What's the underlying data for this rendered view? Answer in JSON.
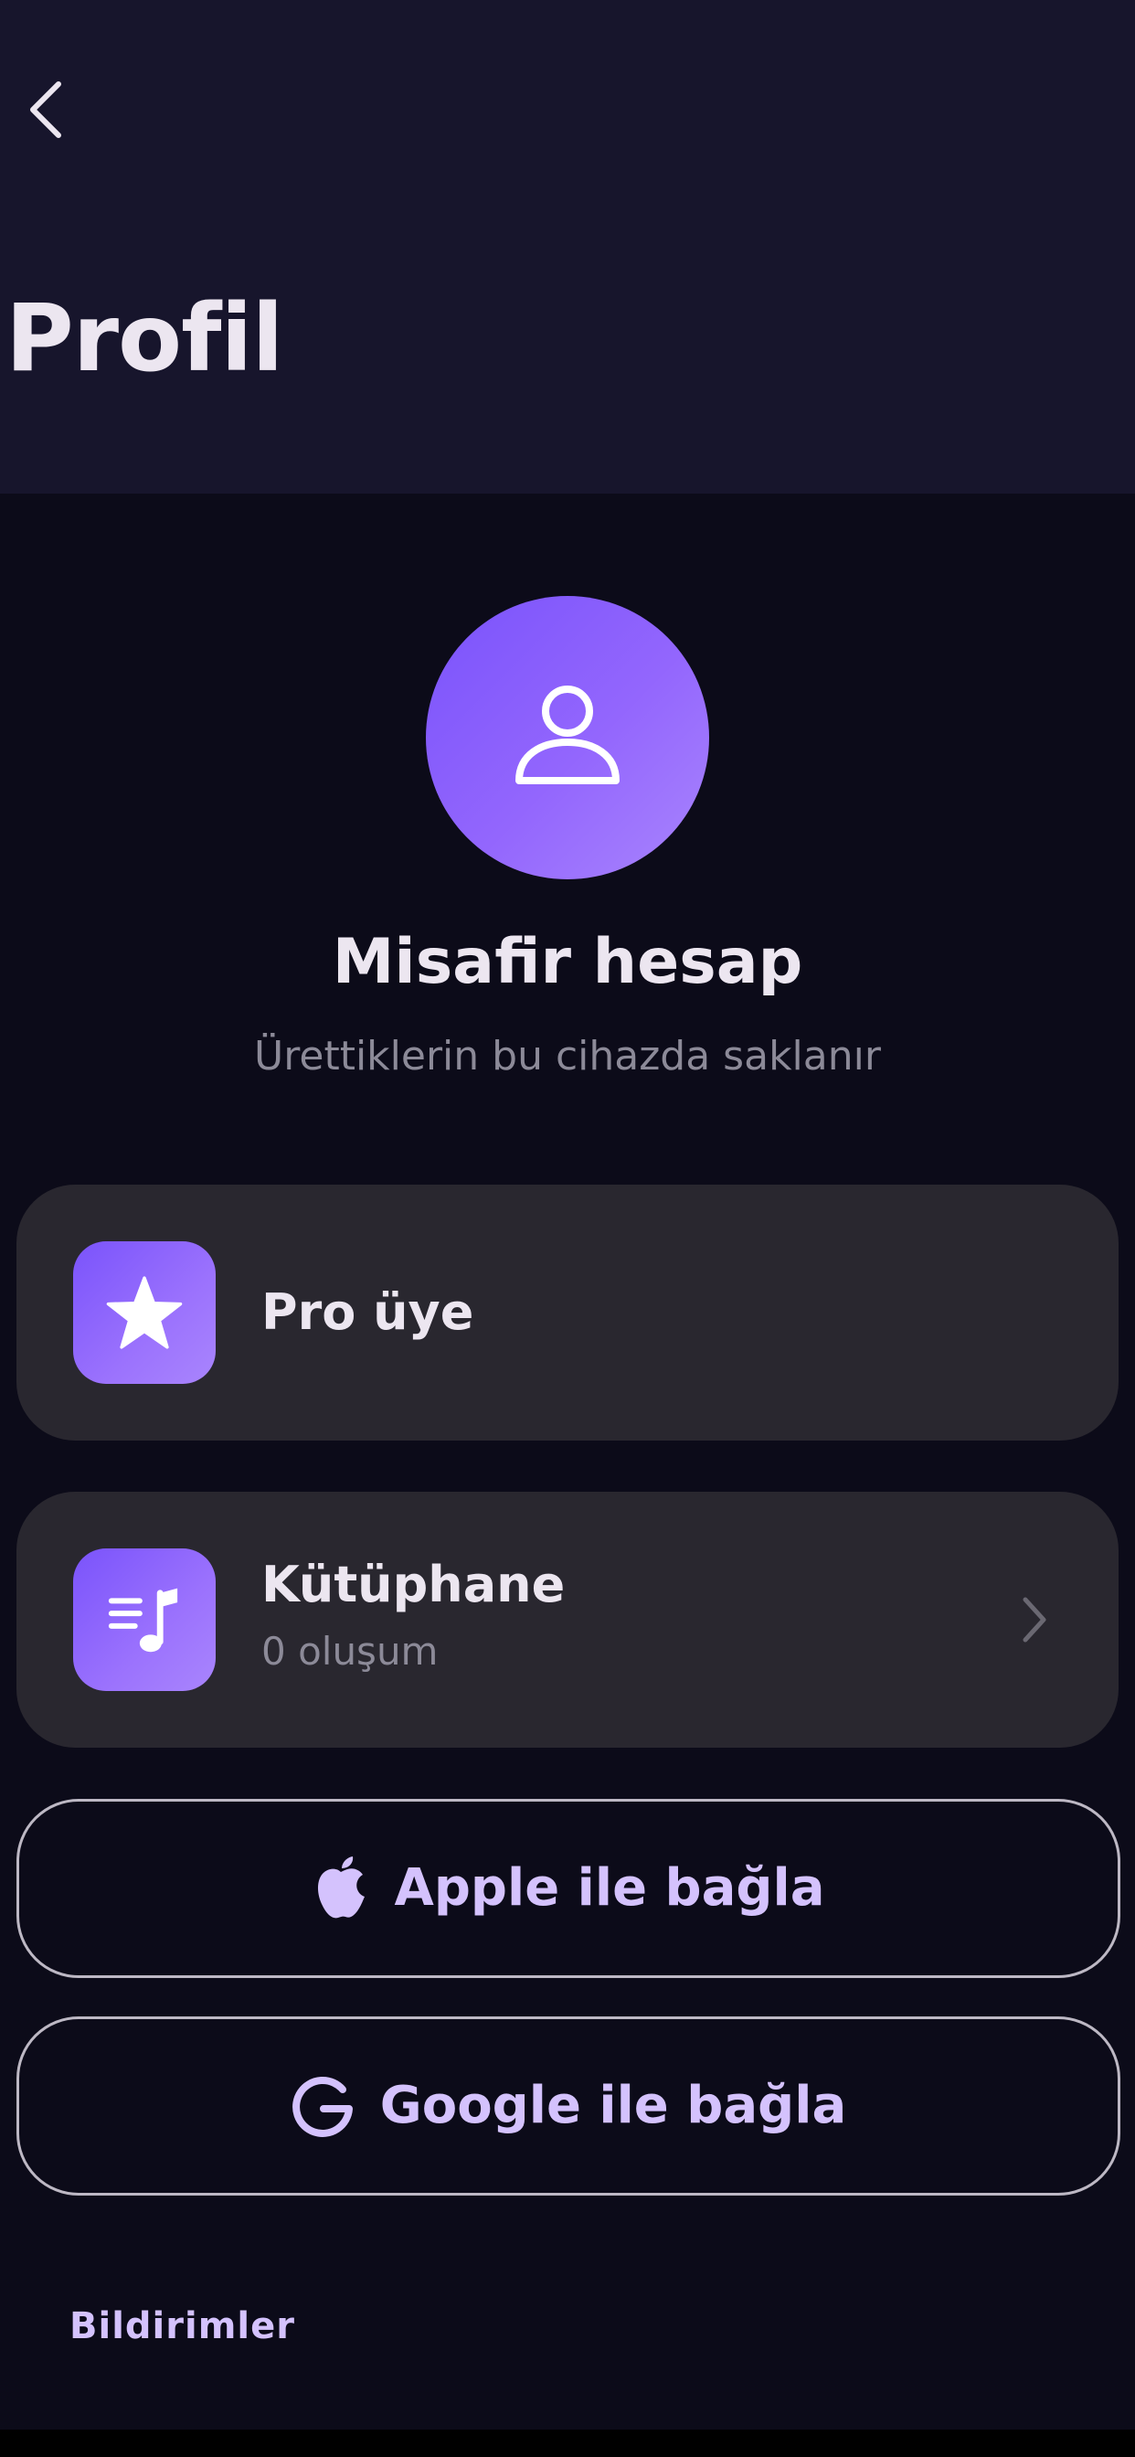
{
  "header": {
    "title": "Profil",
    "back_icon": "chevron-left-icon"
  },
  "profile": {
    "avatar_icon": "user-icon",
    "name": "Misafir hesap",
    "subtitle": "Ürettiklerin bu cihazda saklanır"
  },
  "cards": {
    "pro": {
      "icon": "star-icon",
      "title": "Pro üye"
    },
    "library": {
      "icon": "music-list-icon",
      "title": "Kütüphane",
      "subtitle": "0 oluşum",
      "chevron_icon": "chevron-right-icon"
    }
  },
  "buttons": {
    "apple": {
      "icon": "apple-icon",
      "label": "Apple ile bağla"
    },
    "google": {
      "icon": "google-icon",
      "label": "Google ile bağla"
    }
  },
  "sections": {
    "notifications_label": "Bildirimler"
  },
  "colors": {
    "background": "#0c0b19",
    "header_background": "#17152c",
    "card_background": "#29272f",
    "accent": "#7a53fb",
    "accent_light": "#d4c2fd",
    "text_primary": "#ece6f0",
    "text_secondary": "#8c8a98"
  }
}
